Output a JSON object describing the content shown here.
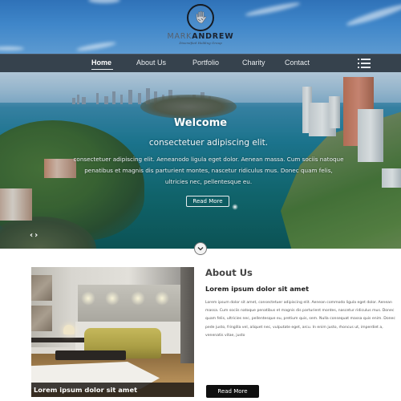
{
  "brand": {
    "name_light": "MARK",
    "name_bold": "ANDREW",
    "tagline": "Diversified Holding Group",
    "logo_icon": "handprint-icon"
  },
  "nav": {
    "items": [
      {
        "label": "Home",
        "active": true
      },
      {
        "label": "About Us",
        "active": false
      },
      {
        "label": "Portfolio",
        "active": false
      },
      {
        "label": "Charity",
        "active": false
      },
      {
        "label": "Contact",
        "active": false
      }
    ],
    "menu_icon": "hamburger-menu-icon"
  },
  "hero": {
    "title": "Welcome",
    "subtitle": "consectetuer adipiscing elit.",
    "body": "consectetuer adipiscing elit. Aeneanodo ligula eget dolor. Aenean massa. Cum sociis natoque penatibus et magnis dis parturient montes, nascetur ridiculus mus. Donec quam felis, ultricies nec, pellentesque eu.",
    "button_label": "Read More",
    "prev_arrow": "‹",
    "next_arrow": "›",
    "scroll_icon": "chevron-down-icon"
  },
  "about": {
    "heading": "About Us",
    "subheading": "Lorem ipsum dolor sit amet",
    "body": "Lorem ipsum dolor sit amet, consectetuer adipiscing elit. Aenean commodo ligula eget dolor. Aenean massa. Cum sociis natoque penatibus et magnis dis parturient montes, nascetur ridiculus mus. Donec quam felis, ultricies nec, pellentesque eu, pretium quis, sem. Nulla consequat massa quis enim. Donec pede justo, fringilla vel, aliquet nec, vulputate eget, arcu. In enim justo, rhoncus ut, imperdiet a, venenatis vitae, justo",
    "image_caption": "Lorem ipsum dolor sit amet",
    "button_label": "Read More"
  },
  "colors": {
    "nav_bg": "#36424d",
    "sky": "#3f86c9",
    "button_dark": "#0f0f0f",
    "text_dark": "#1c1c1c"
  }
}
